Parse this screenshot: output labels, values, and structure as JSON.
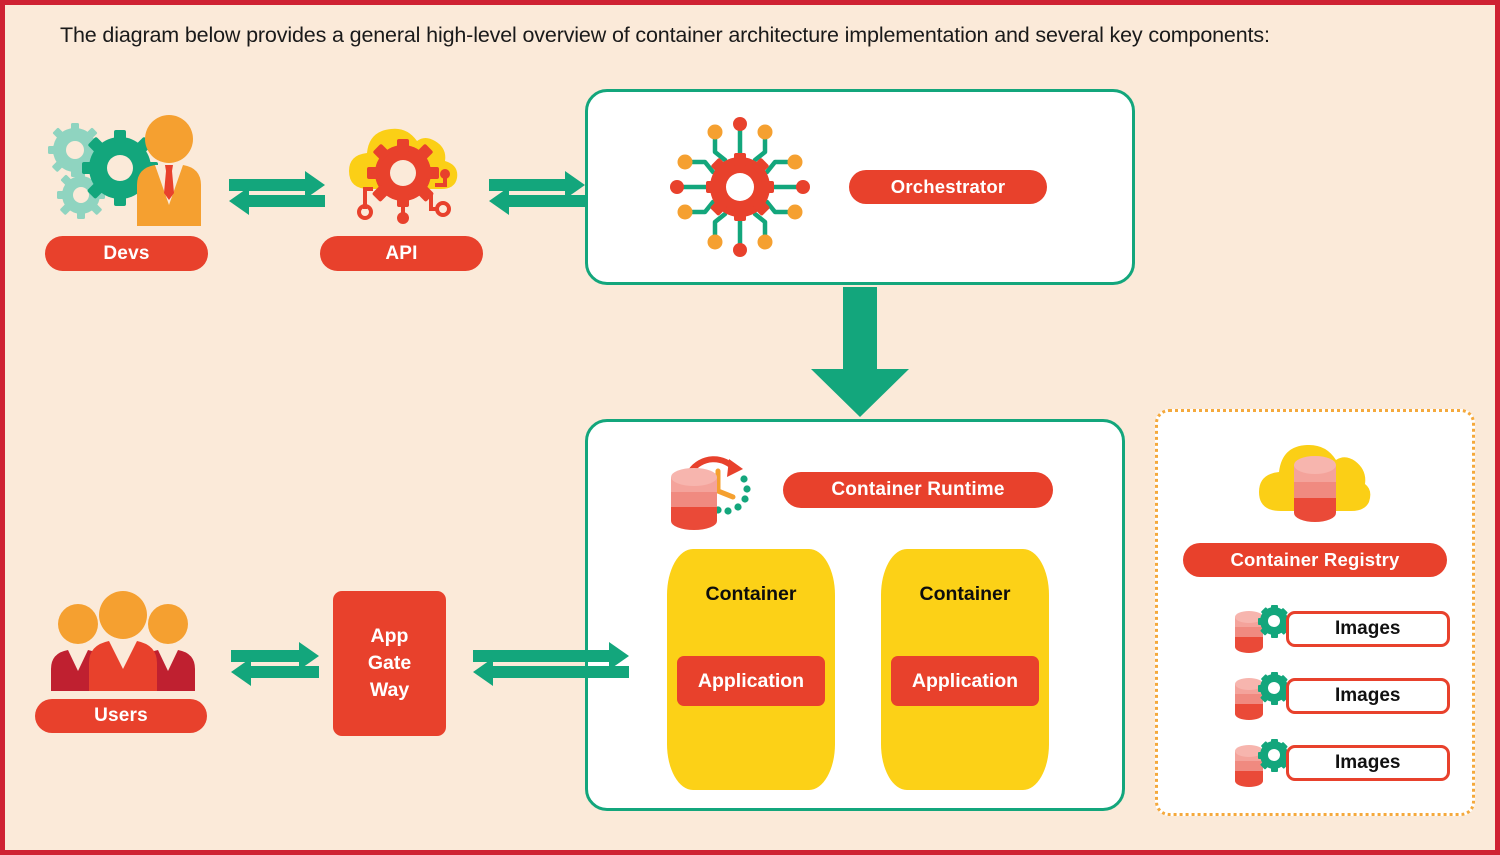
{
  "caption": "The diagram below provides a general high-level overview of container architecture implementation and several key components:",
  "colors": {
    "page_background": "#fbead9",
    "page_border": "#cf2233",
    "accent_red": "#e8412c",
    "accent_green": "#13a67c",
    "accent_yellow": "#fcd117",
    "accent_orange": "#f5a030",
    "cloud_yellow": "#fbcf16",
    "gear_light_teal": "#8fd4c0",
    "registry_border": "#f5a93c"
  },
  "nodes": {
    "devs": {
      "label": "Devs",
      "icon": "developer-gears-icon"
    },
    "api": {
      "label": "API",
      "icon": "cloud-gear-circuit-icon"
    },
    "orchestrator": {
      "label": "Orchestrator",
      "icon": "gear-network-icon"
    },
    "container_runtime": {
      "label": "Container Runtime",
      "icon": "database-clock-icon"
    },
    "container_registry": {
      "label": "Container Registry",
      "icon": "cloud-database-icon"
    },
    "users": {
      "label": "Users",
      "icon": "people-group-icon"
    },
    "gateway": {
      "lines": [
        "App",
        "Gate",
        "Way"
      ]
    }
  },
  "containers": [
    {
      "title": "Container",
      "app_label": "Application"
    },
    {
      "title": "Container",
      "app_label": "Application"
    }
  ],
  "registry_images": [
    {
      "label": "Images",
      "icon": "database-gear-icon"
    },
    {
      "label": "Images",
      "icon": "database-gear-icon"
    },
    {
      "label": "Images",
      "icon": "database-gear-icon"
    }
  ],
  "connectors": [
    {
      "name": "devs-to-api",
      "type": "bidirectional-arrow",
      "direction": "horizontal"
    },
    {
      "name": "api-to-orchestrator",
      "type": "bidirectional-arrow",
      "direction": "horizontal"
    },
    {
      "name": "orchestrator-to-runtime",
      "type": "arrow",
      "direction": "down"
    },
    {
      "name": "users-to-gateway",
      "type": "bidirectional-arrow",
      "direction": "horizontal"
    },
    {
      "name": "gateway-to-runtime",
      "type": "bidirectional-arrow",
      "direction": "horizontal"
    }
  ]
}
